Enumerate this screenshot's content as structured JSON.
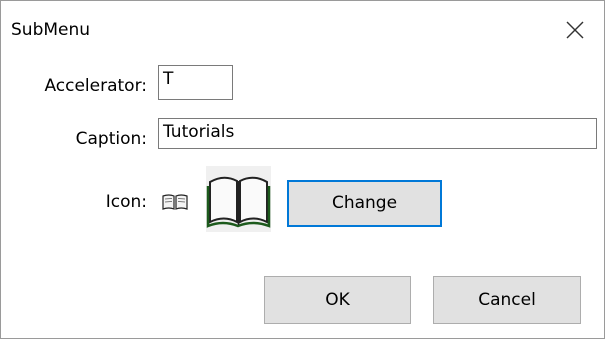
{
  "window": {
    "title": "SubMenu",
    "close_icon": "close-icon"
  },
  "form": {
    "accelerator_label": "Accelerator:",
    "accelerator_value": "T",
    "caption_label": "Caption:",
    "caption_value": "Tutorials",
    "icon_label": "Icon:",
    "small_icon": "open-book-icon",
    "large_icon": "open-book-icon",
    "change_label": "Change"
  },
  "buttons": {
    "ok_label": "OK",
    "cancel_label": "Cancel"
  },
  "colors": {
    "focus_border": "#0078d7",
    "button_face": "#e1e1e1"
  }
}
